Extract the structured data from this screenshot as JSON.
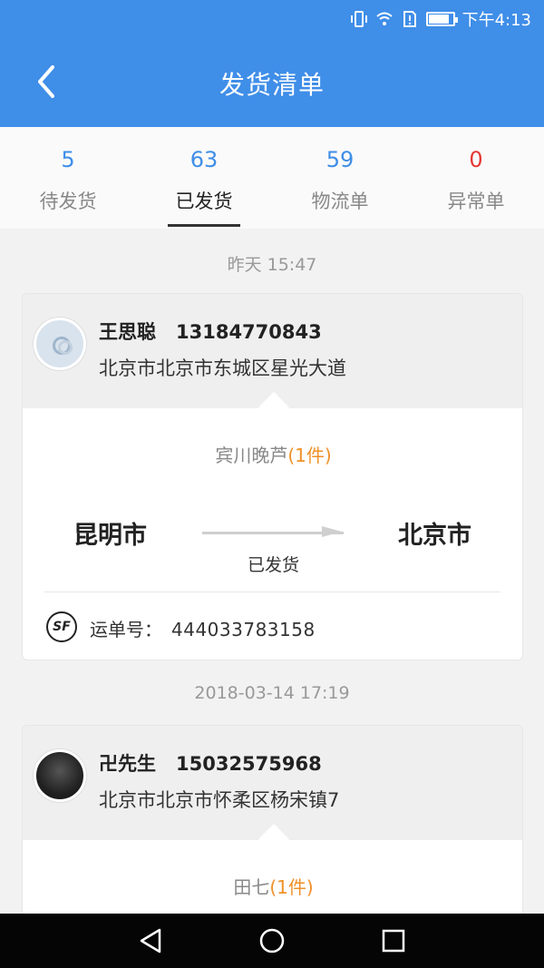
{
  "status_bar": {
    "time": "下午4:13",
    "battery_level": 0.85
  },
  "header": {
    "title": "发货清单"
  },
  "tabs": [
    {
      "count": "5",
      "label": "待发货",
      "active": false
    },
    {
      "count": "63",
      "label": "已发货",
      "active": true
    },
    {
      "count": "59",
      "label": "物流单",
      "active": false
    },
    {
      "count": "0",
      "label": "异常单",
      "active": false
    }
  ],
  "orders": [
    {
      "date": "昨天  15:47",
      "name": "王思聪",
      "phone": "13184770843",
      "address": "北京市北京市东城区星光大道",
      "goods": "宾川晚芦",
      "qty": "(1件)",
      "from_city": "昆明市",
      "to_city": "北京市",
      "status": "已发货",
      "waybill_label": "运单号：",
      "waybill_no": "444033783158",
      "carrier_icon": "SF"
    },
    {
      "date": "2018-03-14 17:19",
      "name": "卍先生",
      "phone": "15032575968",
      "address": "北京市北京市怀柔区杨宋镇7",
      "goods": "田七",
      "qty": "(1件)"
    }
  ],
  "colors": {
    "primary": "#3f8ee8",
    "accent": "#f0912a",
    "alert": "#e53935"
  }
}
